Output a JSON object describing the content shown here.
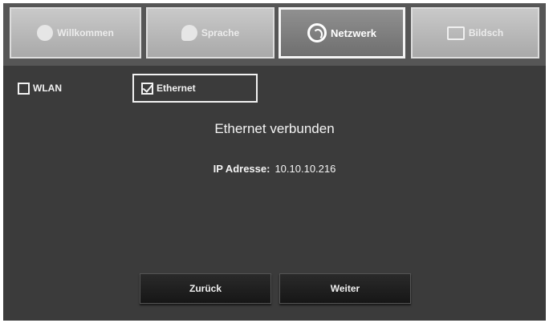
{
  "tabs": [
    {
      "label": "Willkommen",
      "icon": "welcome-icon",
      "active": false
    },
    {
      "label": "Sprache",
      "icon": "speech-bubble-icon",
      "active": false
    },
    {
      "label": "Netzwerk",
      "icon": "network-icon",
      "active": true
    },
    {
      "label": "Bildsch",
      "icon": "screen-icon",
      "active": false
    }
  ],
  "connection": {
    "wlan_label": "WLAN",
    "wlan_checked": false,
    "ethernet_label": "Ethernet",
    "ethernet_checked": true
  },
  "status": {
    "title": "Ethernet verbunden",
    "ip_label": "IP Adresse:",
    "ip_value": "10.10.10.216"
  },
  "buttons": {
    "back_label": "Zurück",
    "next_label": "Weiter"
  },
  "colors": {
    "background": "#3b3b3b",
    "tab_inactive": "#b9b9b9",
    "tab_active": "#808080",
    "text": "#f4f4f4"
  }
}
